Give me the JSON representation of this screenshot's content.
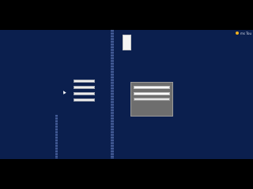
{
  "tray": {
    "status_text": "ms Tou"
  },
  "menu": {
    "buttons": [
      {
        "label": ""
      },
      {
        "label": ""
      },
      {
        "label": ""
      },
      {
        "label": ""
      }
    ]
  },
  "dialog": {
    "field1_value": "",
    "field2_value": "",
    "button_label": ""
  },
  "colors": {
    "background": "#0b1f4e",
    "dialog": "#6e6e6e",
    "tray_icon": "#f0b020"
  }
}
